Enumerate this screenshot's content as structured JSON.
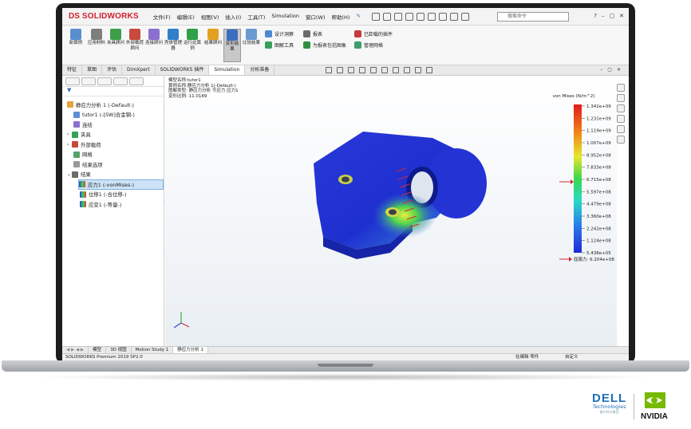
{
  "app": {
    "logo_prefix": "DS",
    "logo_name": "SOLIDWORKS"
  },
  "menu": [
    "文件(F)",
    "编辑(E)",
    "视图(V)",
    "插入(I)",
    "工具(T)",
    "Simulation",
    "窗口(W)",
    "帮助(H)"
  ],
  "search": {
    "placeholder": "搜索命令"
  },
  "ribbon": {
    "buttons": [
      "新算例",
      "应用材料",
      "夹具顾问",
      "外部载荷顾问",
      "连接顾问",
      "壳体管理器",
      "运行此算例",
      "结果顾问",
      "变形结果",
      "比较结果"
    ],
    "lines": [
      "设计洞察",
      "图解工具",
      "报表",
      "为报表包括图象",
      "已卸载的插件",
      "管理网格"
    ]
  },
  "command_tabs": [
    "特征",
    "草图",
    "评估",
    "DimXpert",
    "SOLIDWORKS 插件",
    "Simulation",
    "分析准备"
  ],
  "active_command_tab": "Simulation",
  "tree": {
    "root": "静应力分析 1 (-Default-)",
    "items": [
      "tutor1 (-[SW]合金钢-)",
      "连结",
      "夹具",
      "外部载荷",
      "网格",
      "结果选项",
      "结果"
    ],
    "results": [
      "应力1 (-vonMises-)",
      "位移1 (-合位移-)",
      "应变1 (-等量-)"
    ]
  },
  "info": {
    "model": "模型名称:tutor1",
    "study": "算例名称:静应力分析 1(-Default-)",
    "plot": "图解类型: 静应力分析 节应力 应力1",
    "scale": "变形比例: 11.0189"
  },
  "legend": {
    "title": "von Mises (N/m^2)",
    "values": [
      "1.342e+09",
      "1.231e+09",
      "1.119e+09",
      "1.007e+09",
      "8.952e+08",
      "7.833e+08",
      "6.715e+08",
      "5.597e+08",
      "4.479e+08",
      "3.360e+08",
      "2.242e+08",
      "1.124e+08",
      "5.438e+05"
    ],
    "yield": "屈服力: 6.204e+08"
  },
  "bottom_tabs": [
    "模型",
    "3D 视图",
    "Motion Study 1",
    "静应力分析 1"
  ],
  "status": {
    "left": "SOLIDWORKS Premium 2019 SP2.0",
    "mid": "在编辑 零件",
    "right": "自定义"
  },
  "brands": {
    "dell": "DELL",
    "dell_sub": "Technologies",
    "dell_cn": "戴尔科技集团",
    "nvidia": "NVIDIA"
  }
}
